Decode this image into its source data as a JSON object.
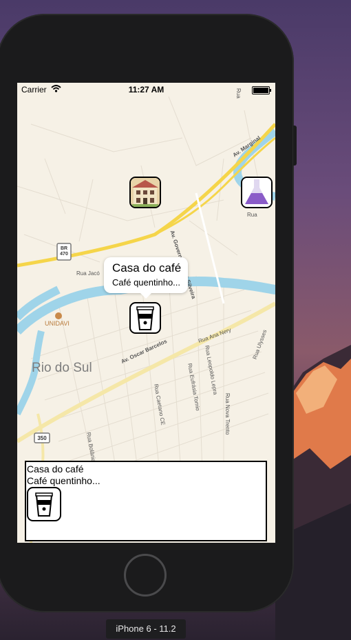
{
  "device": {
    "label": "iPhone 6 - 11.2"
  },
  "statusbar": {
    "carrier": "Carrier",
    "time": "11:27 AM",
    "wifi_icon": "wifi-icon",
    "battery_icon": "battery-icon"
  },
  "map": {
    "city": "Rio do Sul",
    "poi": "UNIDAVI",
    "shields": [
      "BR 470",
      "350"
    ],
    "streets": [
      "Av. Marginal",
      "Av. Governador Ivo Silveira",
      "Rua Jacó",
      "Av. Oscar Barcelos",
      "Rua Ana Nery",
      "Rua Caetano CE",
      "Rua Eufrásia Tomio",
      "Rua Leopoldo Lepra",
      "Rua Ulysses",
      "Rua Nova Trento",
      "Rua Bolânia",
      "Rua",
      "Rua"
    ],
    "pins": [
      {
        "name": "house-pin",
        "icon": "house-icon"
      },
      {
        "name": "flask-pin",
        "icon": "flask-icon"
      },
      {
        "name": "coffee-pin",
        "icon": "coffee-cup-icon"
      }
    ]
  },
  "callout": {
    "title": "Casa do café",
    "subtitle": "Café quentinho..."
  },
  "detail": {
    "title": "Casa do café",
    "subtitle": "Café quentinho...",
    "icon": "coffee-cup-icon"
  },
  "colors": {
    "highway": "#f5d54a",
    "river": "#9fd4e9",
    "land": "#f6f1e6",
    "road": "#ffffff"
  }
}
